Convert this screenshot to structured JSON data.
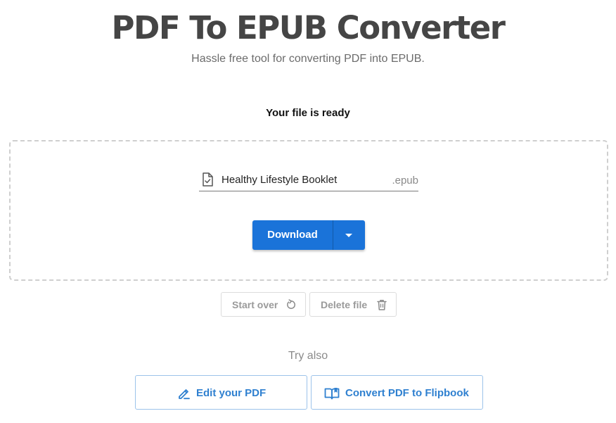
{
  "header": {
    "title": "PDF To EPUB Converter",
    "subtitle": "Hassle free tool for converting PDF into EPUB."
  },
  "status": {
    "ready_text": "Your file is ready"
  },
  "file": {
    "icon": "file-check-icon",
    "name": "Healthy Lifestyle Booklet",
    "extension": ".epub"
  },
  "download": {
    "label": "Download",
    "dropdown_icon": "caret-down-icon",
    "color": "#1a73d9"
  },
  "actions": {
    "start_over": {
      "label": "Start over",
      "icon": "refresh-icon"
    },
    "delete_file": {
      "label": "Delete file",
      "icon": "trash-icon"
    }
  },
  "try_also": {
    "heading": "Try also",
    "items": [
      {
        "label": "Edit your PDF",
        "icon": "pencil-icon"
      },
      {
        "label": "Convert PDF to Flipbook",
        "icon": "book-icon"
      }
    ],
    "accent": "#2f80d0"
  }
}
